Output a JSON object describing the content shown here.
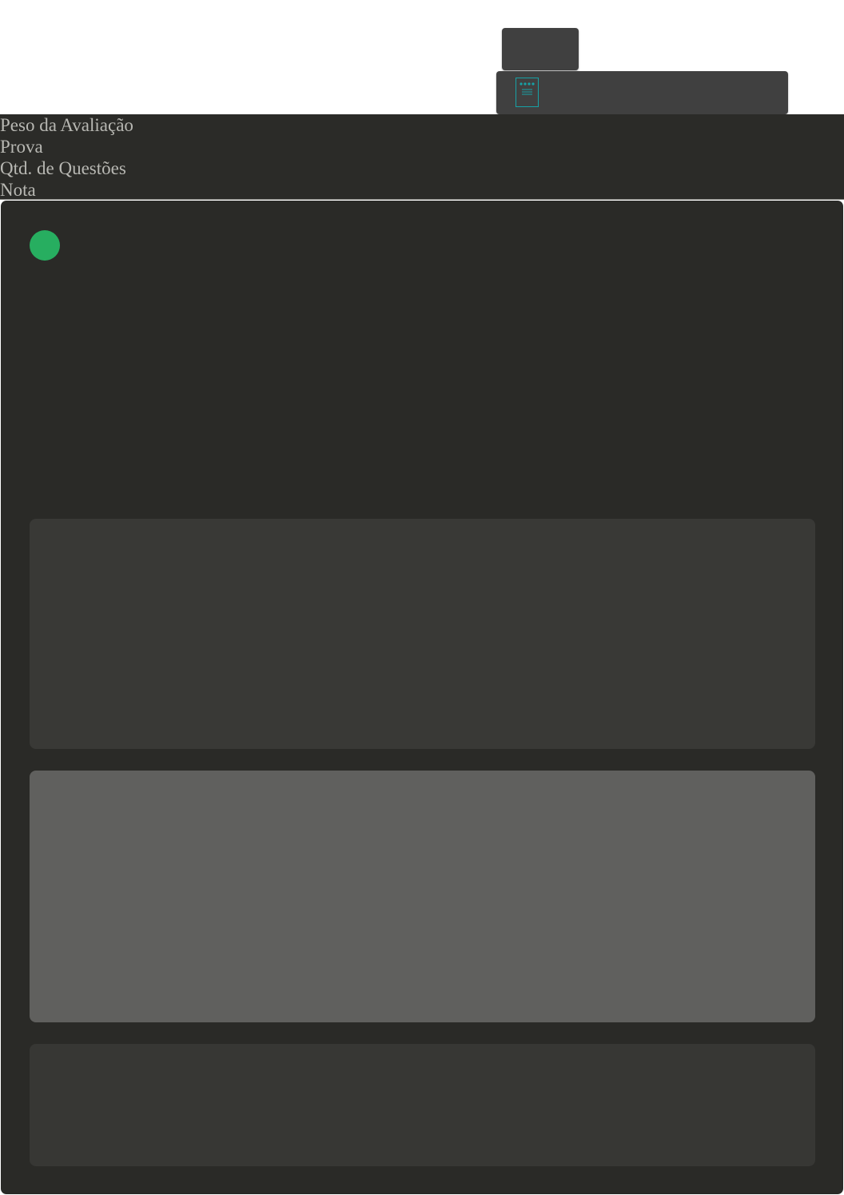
{
  "fields": {
    "peso_label": "Peso da Avaliação",
    "prova_label": "Prova",
    "qtd_questoes_label": "Qtd. de Questões",
    "nota_label": "Nota"
  },
  "icons": {
    "toolbar_icon": "document-icon",
    "status": "status-dot-icon"
  },
  "colors": {
    "status": "#27ae60",
    "toolbar_icon": "#17a2a6",
    "panel_background": "#2a2a27",
    "toolbar_background": "#404040"
  }
}
